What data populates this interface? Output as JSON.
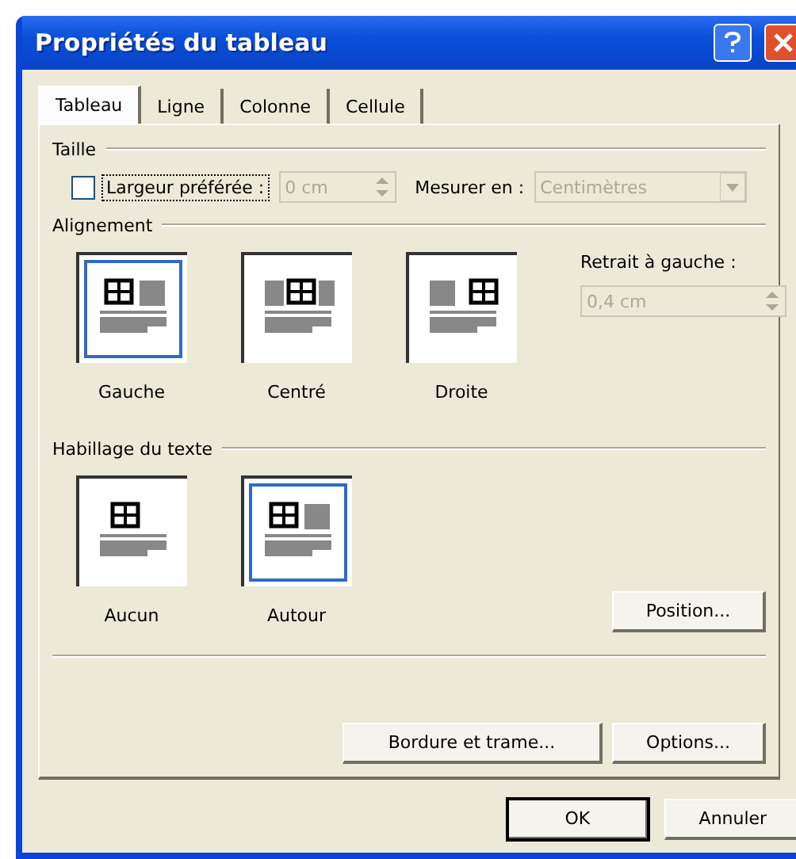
{
  "window": {
    "title": "Propriétés du tableau"
  },
  "tabs": [
    {
      "label": "Tableau",
      "selected": true
    },
    {
      "label": "Ligne",
      "selected": false
    },
    {
      "label": "Colonne",
      "selected": false
    },
    {
      "label": "Cellule",
      "selected": false
    }
  ],
  "size": {
    "heading": "Taille",
    "checkbox": {
      "label": "Largeur préférée :",
      "checked": false
    },
    "width_field": {
      "value": "0 cm",
      "disabled": true
    },
    "measure_label": "Mesurer en :",
    "measure_select": {
      "value": "Centimètres",
      "disabled": true
    }
  },
  "alignment": {
    "heading": "Alignement",
    "options": [
      {
        "label": "Gauche",
        "kind": "left",
        "selected": true
      },
      {
        "label": "Centré",
        "kind": "center",
        "selected": false
      },
      {
        "label": "Droite",
        "kind": "right",
        "selected": false
      }
    ],
    "indent_label": "Retrait à gauche :",
    "indent_field": {
      "value": "0,4 cm",
      "disabled": true
    }
  },
  "wrapping": {
    "heading": "Habillage du texte",
    "options": [
      {
        "label": "Aucun",
        "kind": "none",
        "selected": false
      },
      {
        "label": "Autour",
        "kind": "around",
        "selected": true
      }
    ],
    "position_button": "Position..."
  },
  "buttons": [
    "Bordure et trame...",
    "Options..."
  ],
  "footer_buttons": [
    "OK",
    "Annuler"
  ]
}
